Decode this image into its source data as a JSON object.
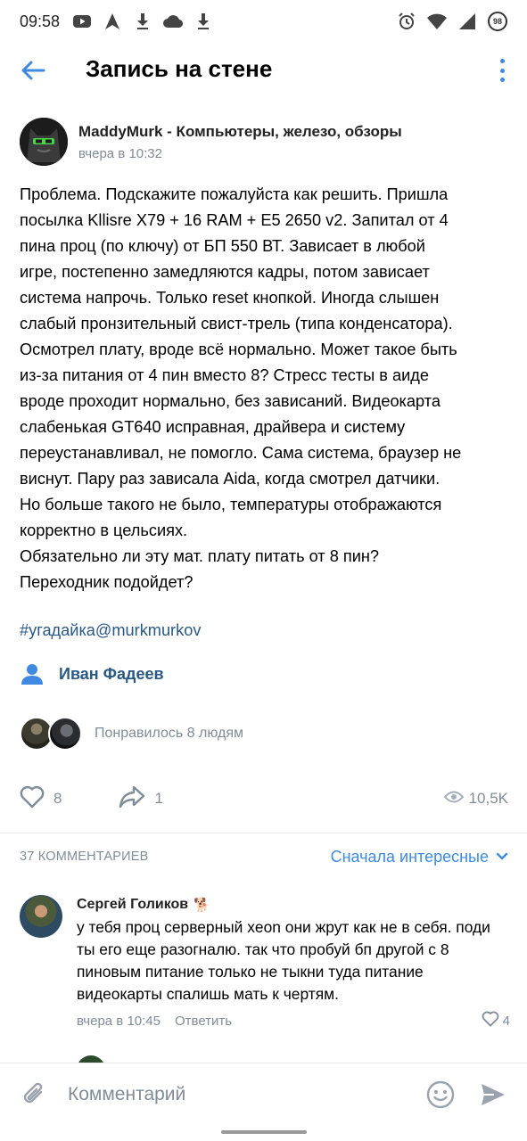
{
  "status_bar": {
    "time": "09:58",
    "battery": "98",
    "left_icons": [
      "youtube-icon",
      "navigation-icon",
      "download-icon",
      "cloud-icon",
      "download-icon"
    ],
    "right_icons": [
      "alarm-icon",
      "wifi-icon",
      "signal-icon",
      "battery-icon"
    ]
  },
  "header": {
    "title": "Запись на стене"
  },
  "post": {
    "author_name": "MaddyMurk - Компьютеры, железо, обзоры",
    "date": "вчера в 10:32",
    "text": "Проблема. Подскажите пожалуйста как решить. Пришла\nпосылка Kllisre X79 + 16 RAM + E5 2650 v2. Запитал от 4\nпина проц (по ключу) от БП 550 ВТ. Зависает в любой\nигре, постепенно замедляются кадры, потом зависает\nсистема напрочь. Только reset кнопкой. Иногда слышен\nслабый пронзительный свист-трель (типа конденсатора).\nОсмотрел плату, вроде всё нормально. Может такое быть\nиз-за питания от 4 пин вместо 8? Стресс тесты в аиде\nвроде проходит нормально, без зависаний. Видеокарта\nслабенькая GT640 исправная, драйвера и систему\nпереустанавливал, не помогло. Сама система, браузер не\nвиснут. Пару раз зависала Aida, когда смотрел датчики.\nНо больше такого не было, температуры отображаются\nкорректно в цельсиях.\nОбязательно ли эту мат. плату питать от 8 пин?\nПереходник подойдет?",
    "hashtag": "#угадайка@murkmurkov",
    "signer": "Иван Фадеев",
    "liked_text": "Понравилось 8 людям",
    "likes": "8",
    "shares": "1",
    "views": "10,5K"
  },
  "comments_section": {
    "count_label": "37 КОММЕНТАРИЕВ",
    "sort_label": "Сначала интересные"
  },
  "comment": {
    "name": "Сергей Голиков",
    "badge": "🐕",
    "text": "у тебя проц серверный xeon они жрут как не в себя. поди ты его еще разогналю. так что пробуй бп другой с 8 пиновым питание только не тыкни туда питание видеокарты спалишь мать к чертям.",
    "date": "вчера в 10:45",
    "reply_label": "Ответить",
    "likes": "4"
  },
  "composer": {
    "placeholder": "Комментарий"
  },
  "colors": {
    "accent": "#3f8ae0",
    "link": "#2a5885",
    "secondary": "#818c99"
  }
}
